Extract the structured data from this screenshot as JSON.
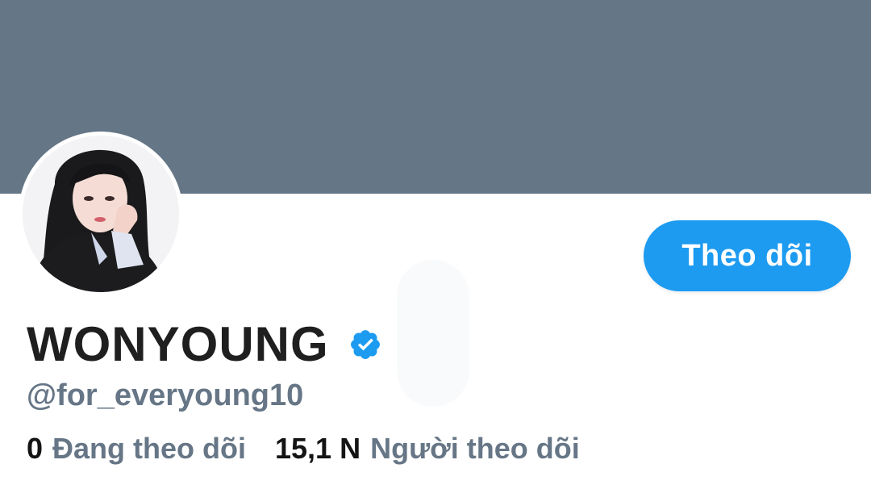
{
  "colors": {
    "banner": "#657686",
    "accent": "#1d9bf0",
    "secondary_text": "#667686",
    "primary_text": "#1f1f1f",
    "verified": "#1d9bf0"
  },
  "profile": {
    "display_name": "WONYOUNG",
    "handle": "@for_everyoung10",
    "verified_icon": "verified-badge-icon",
    "avatar": "profile-photo"
  },
  "actions": {
    "follow_label": "Theo dõi"
  },
  "stats": {
    "following_count": "0",
    "following_label": "Đang theo dõi",
    "followers_count": "15,1 N",
    "followers_label": "Người theo dõi"
  }
}
